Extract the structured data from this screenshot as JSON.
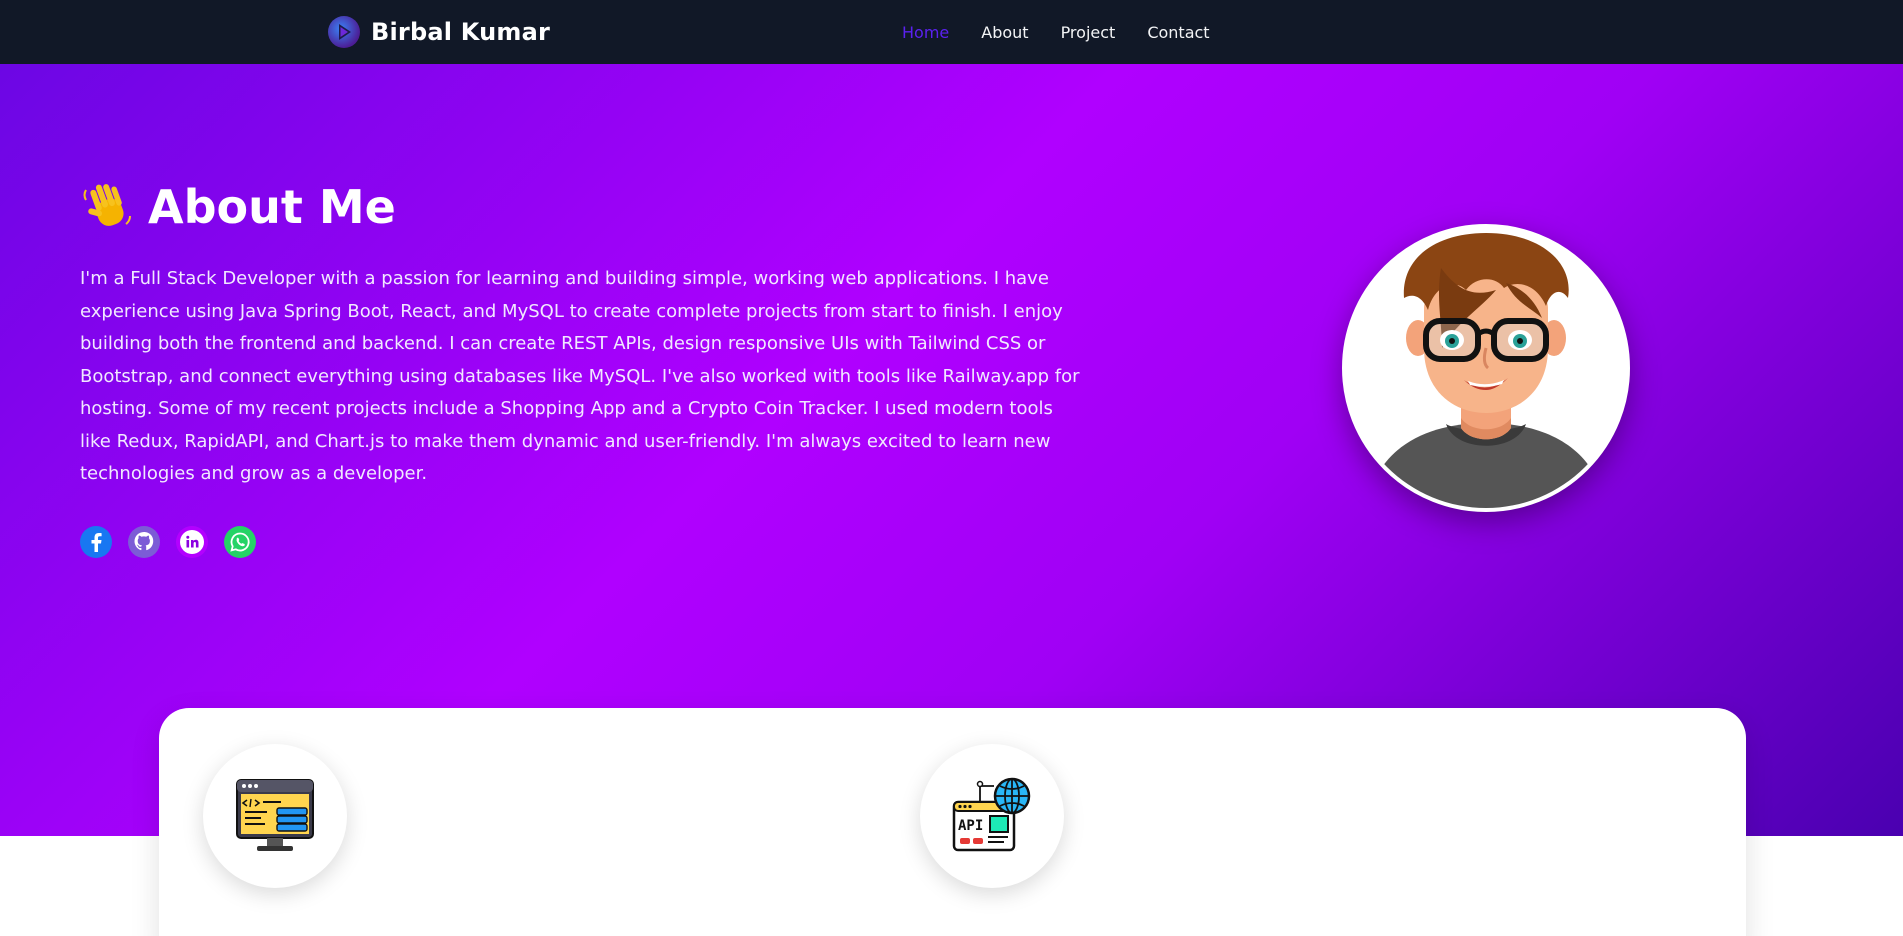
{
  "navbar": {
    "brand_name": "Birbal Kumar",
    "links": [
      {
        "label": "Home",
        "active": true
      },
      {
        "label": "About",
        "active": false
      },
      {
        "label": "Project",
        "active": false
      },
      {
        "label": "Contact",
        "active": false
      }
    ]
  },
  "hero": {
    "heading": "About Me",
    "paragraph": "I'm a Full Stack Developer with a passion for learning and building simple, working web applications. I have experience using Java Spring Boot, React, and MySQL to create complete projects from start to finish. I enjoy building both the frontend and backend. I can create REST APIs, design responsive UIs with Tailwind CSS or Bootstrap, and connect everything using databases like MySQL. I've also worked with tools like Railway.app for hosting. Some of my recent projects include a Shopping App and a Crypto Coin Tracker. I used modern tools like Redux, RapidAPI, and Chart.js to make them dynamic and user-friendly. I'm always excited to learn new technologies and grow as a developer.",
    "socials": [
      "facebook-icon",
      "github-icon",
      "linkedin-icon",
      "whatsapp-icon"
    ]
  },
  "skills": {
    "items": [
      {
        "icon": "web-development-icon",
        "title": ""
      },
      {
        "icon": "api-icon",
        "title": ""
      }
    ]
  },
  "colors": {
    "navbar_bg": "#111827",
    "nav_active": "#5b21f0",
    "hero_gradient_start": "#6c06e4",
    "hero_gradient_mid": "#b000ff",
    "hero_gradient_end": "#4a00b0"
  }
}
